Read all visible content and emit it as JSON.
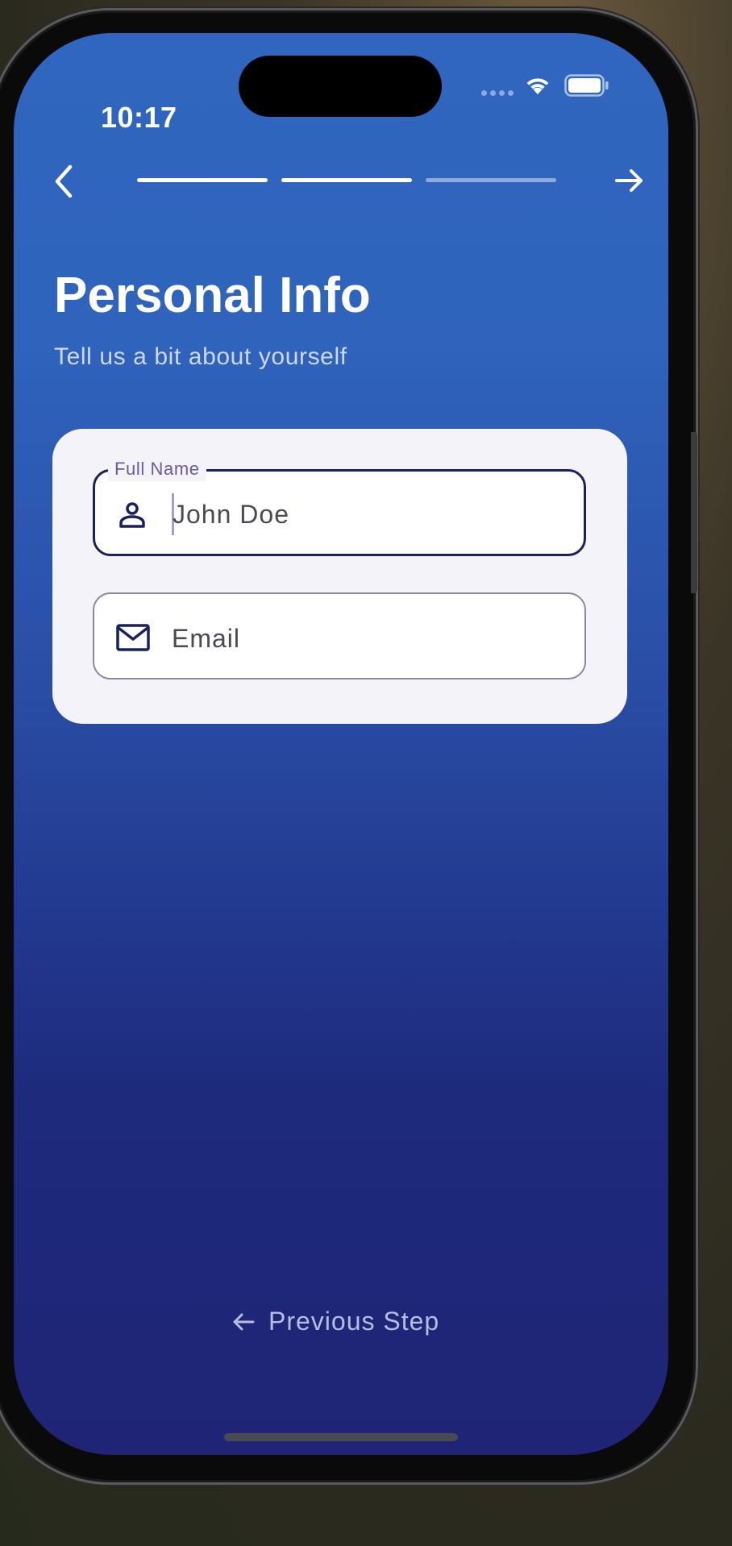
{
  "status_bar": {
    "time": "10:17",
    "wifi_icon": "wifi-icon",
    "battery_icon": "battery-icon"
  },
  "nav": {
    "back_icon": "chevron-left-icon",
    "forward_icon": "arrow-right-icon"
  },
  "progress": {
    "total_steps": 3,
    "completed_steps": 2
  },
  "header": {
    "title": "Personal Info",
    "subtitle": "Tell us a bit about yourself"
  },
  "form": {
    "full_name": {
      "label": "Full Name",
      "placeholder": "John Doe",
      "icon": "person-icon",
      "focused": true
    },
    "email": {
      "placeholder": "Email",
      "icon": "mail-icon"
    }
  },
  "footer": {
    "previous_label": "Previous Step",
    "previous_icon": "arrow-left-icon"
  },
  "colors": {
    "gradient_top": "#3066bf",
    "gradient_bottom": "#1f2476",
    "card_background": "#f3f3f9",
    "focused_border": "#17225e",
    "label_color": "#6b5aa2",
    "footer_text": "#b7bde0"
  }
}
